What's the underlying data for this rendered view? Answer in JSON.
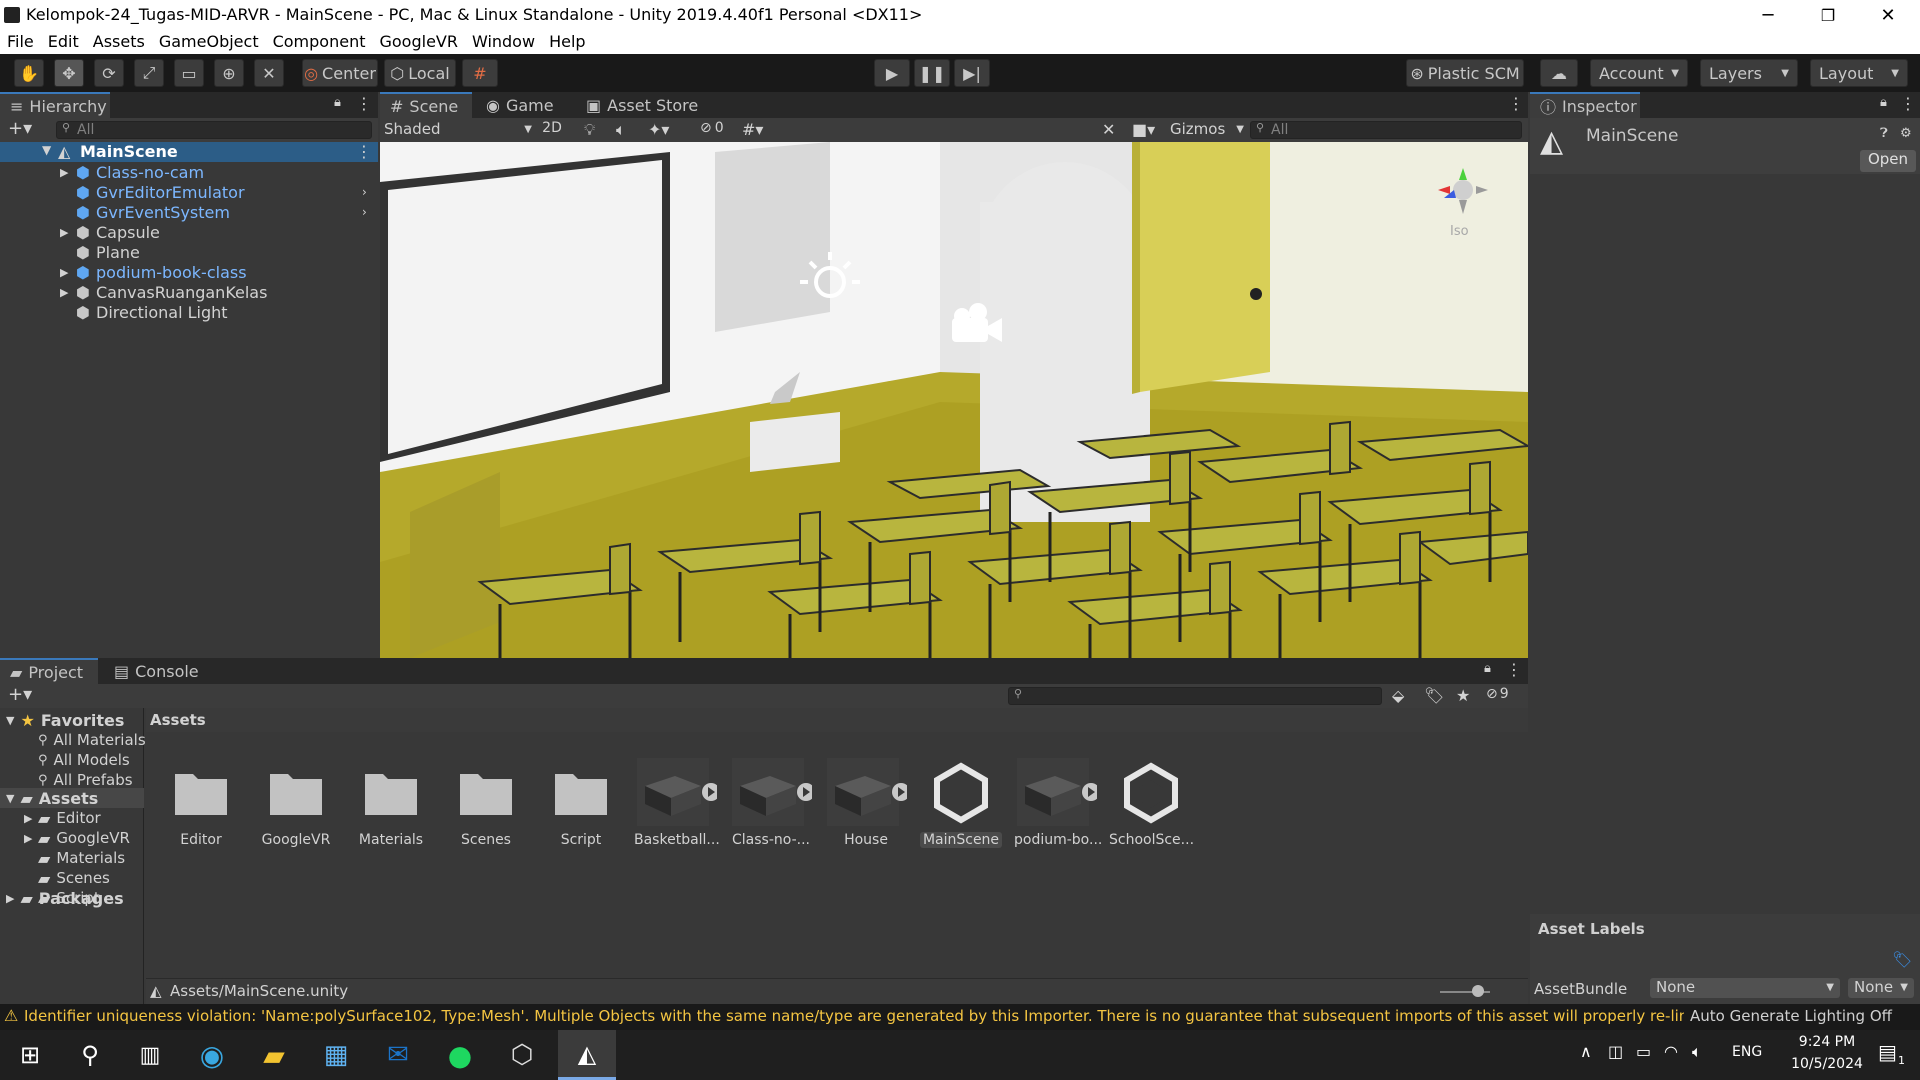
{
  "window": {
    "title": "Kelompok-24_Tugas-MID-ARVR - MainScene - PC, Mac & Linux Standalone - Unity 2019.4.40f1 Personal <DX11>",
    "minimize": "─",
    "maximize": "❐",
    "close": "✕"
  },
  "menu": [
    "File",
    "Edit",
    "Assets",
    "GameObject",
    "Component",
    "GoogleVR",
    "Window",
    "Help"
  ],
  "toolbar": {
    "pivot_label": "Center",
    "space_label": "Local",
    "plastic_label": "Plastic SCM",
    "account_label": "Account",
    "layers_label": "Layers",
    "layout_label": "Layout"
  },
  "hierarchy": {
    "tab": "Hierarchy",
    "search_placeholder": "All",
    "scene": "MainScene",
    "items": [
      {
        "label": "Class-no-cam",
        "prefab": true,
        "expand": "▶"
      },
      {
        "label": "GvrEditorEmulator",
        "prefab": true,
        "expand": ""
      },
      {
        "label": "GvrEventSystem",
        "prefab": true,
        "expand": ""
      },
      {
        "label": "Capsule",
        "prefab": false,
        "expand": "▶"
      },
      {
        "label": "Plane",
        "prefab": false,
        "expand": ""
      },
      {
        "label": "podium-book-class",
        "prefab": true,
        "expand": "▶"
      },
      {
        "label": "CanvasRuanganKelas",
        "prefab": false,
        "expand": "▶"
      },
      {
        "label": "Directional Light",
        "prefab": false,
        "expand": ""
      }
    ]
  },
  "scene": {
    "tabs": [
      "Scene",
      "Game",
      "Asset Store"
    ],
    "shading": "Shaded",
    "mode2d": "2D",
    "hidden_count": "0",
    "gizmos": "Gizmos",
    "search_placeholder": "All",
    "view_label": "Iso"
  },
  "inspector": {
    "tab": "Inspector",
    "object_name": "MainScene",
    "open_button": "Open",
    "asset_labels": "Asset Labels",
    "asset_bundle_label": "AssetBundle",
    "bundle_value": "None",
    "variant_value": "None"
  },
  "project": {
    "tabs": [
      "Project",
      "Console"
    ],
    "hidden_count": "9",
    "favorites_label": "Favorites",
    "favorites": [
      "All Materials",
      "All Models",
      "All Prefabs"
    ],
    "assets_label": "Assets",
    "asset_folders": [
      "Editor",
      "GoogleVR",
      "Materials",
      "Scenes",
      "Script"
    ],
    "packages_label": "Packages",
    "breadcrumb": "Assets",
    "footer_path": "Assets/MainScene.unity",
    "tiles": [
      {
        "label": "Editor",
        "kind": "folder"
      },
      {
        "label": "GoogleVR",
        "kind": "folder"
      },
      {
        "label": "Materials",
        "kind": "folder"
      },
      {
        "label": "Scenes",
        "kind": "folder"
      },
      {
        "label": "Script",
        "kind": "folder"
      },
      {
        "label": "Basketball...",
        "kind": "model"
      },
      {
        "label": "Class-no-...",
        "kind": "model"
      },
      {
        "label": "House",
        "kind": "model"
      },
      {
        "label": "MainScene",
        "kind": "unity"
      },
      {
        "label": "podium-bo...",
        "kind": "model"
      },
      {
        "label": "SchoolSce...",
        "kind": "unity"
      }
    ]
  },
  "status": {
    "warning": "Identifier uniqueness violation: 'Name:polySurface102, Type:Mesh'. Multiple Objects with the same name/type are generated by this Importer. There is no guarantee that subsequent imports of this asset will properly re-link to these",
    "lighting": "Auto Generate Lighting Off"
  },
  "taskbar": {
    "language": "ENG",
    "time": "9:24 PM",
    "date": "10/5/2024",
    "notifications": "1"
  },
  "colors": {
    "accent": "#3a79bb",
    "prefab": "#7cb7ff",
    "warning": "#f4c542"
  }
}
